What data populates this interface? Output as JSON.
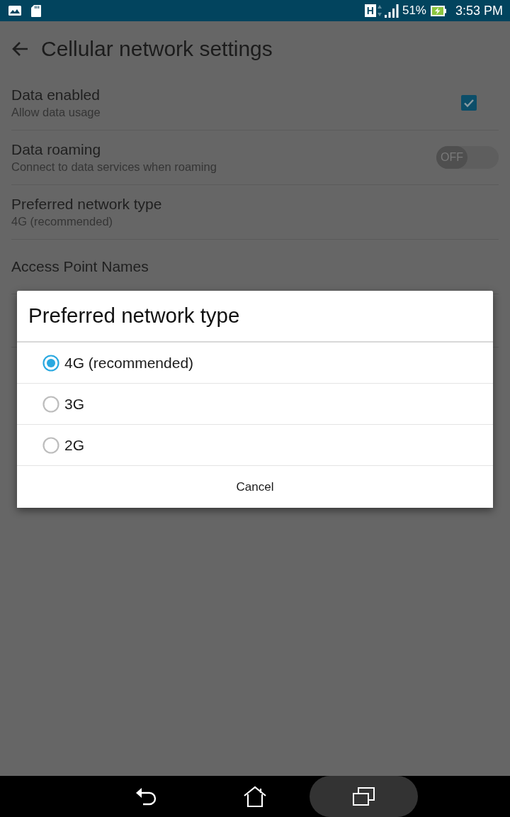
{
  "status_bar": {
    "network_type": "H",
    "battery": "51%",
    "time": "3:53 PM"
  },
  "app_bar": {
    "title": "Cellular network settings"
  },
  "settings": [
    {
      "kind": "checkbox",
      "title": "Data enabled",
      "summary": "Allow data usage",
      "checked": true
    },
    {
      "kind": "switch",
      "title": "Data roaming",
      "summary": "Connect to data services when roaming",
      "on": false,
      "switch_label": "OFF"
    },
    {
      "kind": "plain",
      "title": "Preferred network type",
      "summary": "4G (recommended)"
    },
    {
      "kind": "plain",
      "title": "Access Point Names"
    }
  ],
  "dialog": {
    "title": "Preferred network type",
    "options": [
      {
        "label": "4G (recommended)",
        "selected": true
      },
      {
        "label": "3G",
        "selected": false
      },
      {
        "label": "2G",
        "selected": false
      }
    ],
    "cancel": "Cancel"
  },
  "nav_bar": {
    "buttons": [
      {
        "kind": "back",
        "pressed": false
      },
      {
        "kind": "home",
        "pressed": false
      },
      {
        "kind": "recent",
        "pressed": true
      }
    ]
  }
}
